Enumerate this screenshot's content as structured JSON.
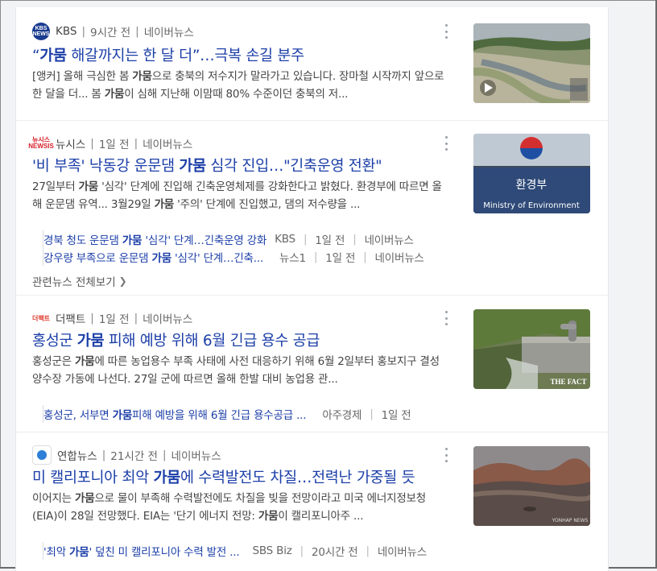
{
  "articles": [
    {
      "press": "KBS",
      "logo_text": "KBS NEWS",
      "time": "9시간 전",
      "source": "네이버뉴스",
      "title_parts": [
        "“",
        "가뭄",
        " 해갈까지는 한 달 더”…극복 손길 분주"
      ],
      "desc_parts": [
        "[앵커] 올해 극심한 봄 ",
        "가뭄",
        "으로 충북의 저수지가 말라가고 있습니다. 장마철 시작까지 앞으로 한 달을 더... 봄 ",
        "가뭄",
        "이 심해 지난해 이맘때 80% 수준이던 충북의 저..."
      ],
      "thumb_icon": "reservoir-aerial-image"
    },
    {
      "press": "뉴시스",
      "logo_text": "뉴시스",
      "time": "1일 전",
      "source": "네이버뉴스",
      "title_parts": [
        "'비 부족' 낙동강 운문댐 ",
        "가뭄",
        " 심각 진입…\"긴축운영 전환\""
      ],
      "desc_parts": [
        "27일부터 ",
        "가뭄",
        " '심각' 단계에 진입해 긴축운영체제를 강화한다고 밝혔다. 환경부에 따르면 올해 운문댐 유역... 3월29일 ",
        "가뭄",
        " '주의' 단계에 진입했고, 댐의 저수량을 ..."
      ],
      "thumb_text_main": "환경부",
      "thumb_text_sub": "Ministry of Environment",
      "sub_news": [
        {
          "title_parts": [
            "경북 청도 운문댐 ",
            "가뭄",
            " '심각' 단계…긴축운영 강화"
          ],
          "press": "KBS",
          "time": "1일 전",
          "source": "네이버뉴스"
        },
        {
          "title_parts": [
            "강우량 부족으로 운문댐 ",
            "가뭄",
            " '심각' 단계…긴축..."
          ],
          "press": "뉴스1",
          "time": "1일 전",
          "source": "네이버뉴스"
        }
      ],
      "related_label": "관련뉴스 전체보기"
    },
    {
      "press": "더팩트",
      "logo_text": "더팩트",
      "time": "1일 전",
      "source": "네이버뉴스",
      "title_parts": [
        "홍성군 ",
        "가뭄",
        " 피해 예방 위해 6월 긴급 용수 공급"
      ],
      "desc_parts": [
        "홍성군은 ",
        "가뭄",
        "에 따른 농업용수 부족 사태에 사전 대응하기 위해 6월 2일부터 홍보지구 결성양수장 가동에 나선다. 27일 군에 따르면 올해 한발 대비 농업용 관..."
      ],
      "thumb_text": "THE FACT",
      "sub_news": [
        {
          "title_parts": [
            "홍성군, 서부면 ",
            "가뭄",
            "피해 예방을 위해 6월 긴급 용수공급 ..."
          ],
          "press": "아주경제",
          "time": "1일 전",
          "source": ""
        }
      ]
    },
    {
      "press": "연합뉴스",
      "logo_text": "",
      "time": "21시간 전",
      "source": "네이버뉴스",
      "title_parts": [
        "미 캘리포니아 최악 ",
        "가뭄",
        "에 수력발전도 차질…전력난 가중될 듯"
      ],
      "desc_parts": [
        "이어지는 ",
        "가뭄",
        "으로 물이 부족해 수력발전에도 차질을 빚을 전망이라고 미국 에너지정보청(EIA)이 28일 전망했다. EIA는 '단기 에너지 전망: ",
        "가뭄",
        "이 캘리포니아주 ..."
      ],
      "thumb_text": "YONHAP NEWS",
      "sub_news": [
        {
          "title_parts": [
            "'최악 ",
            "가뭄",
            "' 덮친 미 캘리포니아 수력 발전 ..."
          ],
          "press": "SBS Biz",
          "time": "20시간 전",
          "source": "네이버뉴스"
        }
      ]
    }
  ],
  "colors": {
    "title_link": "#1c3fa8",
    "divider": "#ebedf0",
    "background": "#f2f3f5"
  }
}
